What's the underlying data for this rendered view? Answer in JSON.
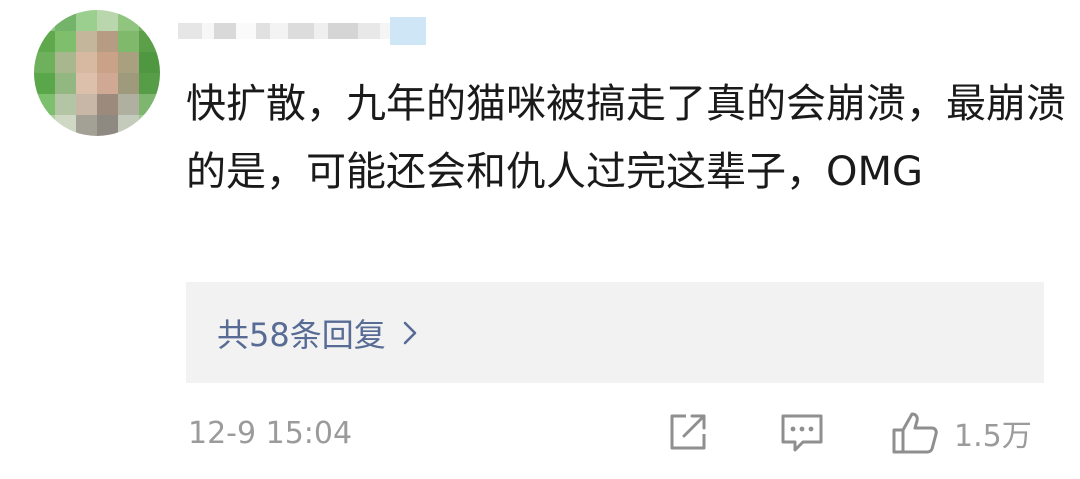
{
  "user": {
    "avatar_label": "blurred-avatar",
    "name_label": "blurred-username"
  },
  "comment": {
    "text": "快扩散，九年的猫咪被搞走了真的会崩溃，最崩溃的是，可能还会和仇人过完这辈子，OMG"
  },
  "replies": {
    "label": "共58条回复"
  },
  "footer": {
    "timestamp": "12-9 15:04",
    "like_count": "1.5万"
  },
  "colors": {
    "link": "#576b95",
    "meta": "#9b9b9b",
    "reply_bg": "#f2f2f2"
  },
  "icons": [
    "share-icon",
    "comment-icon",
    "thumbs-up-icon",
    "chevron-right-icon"
  ]
}
